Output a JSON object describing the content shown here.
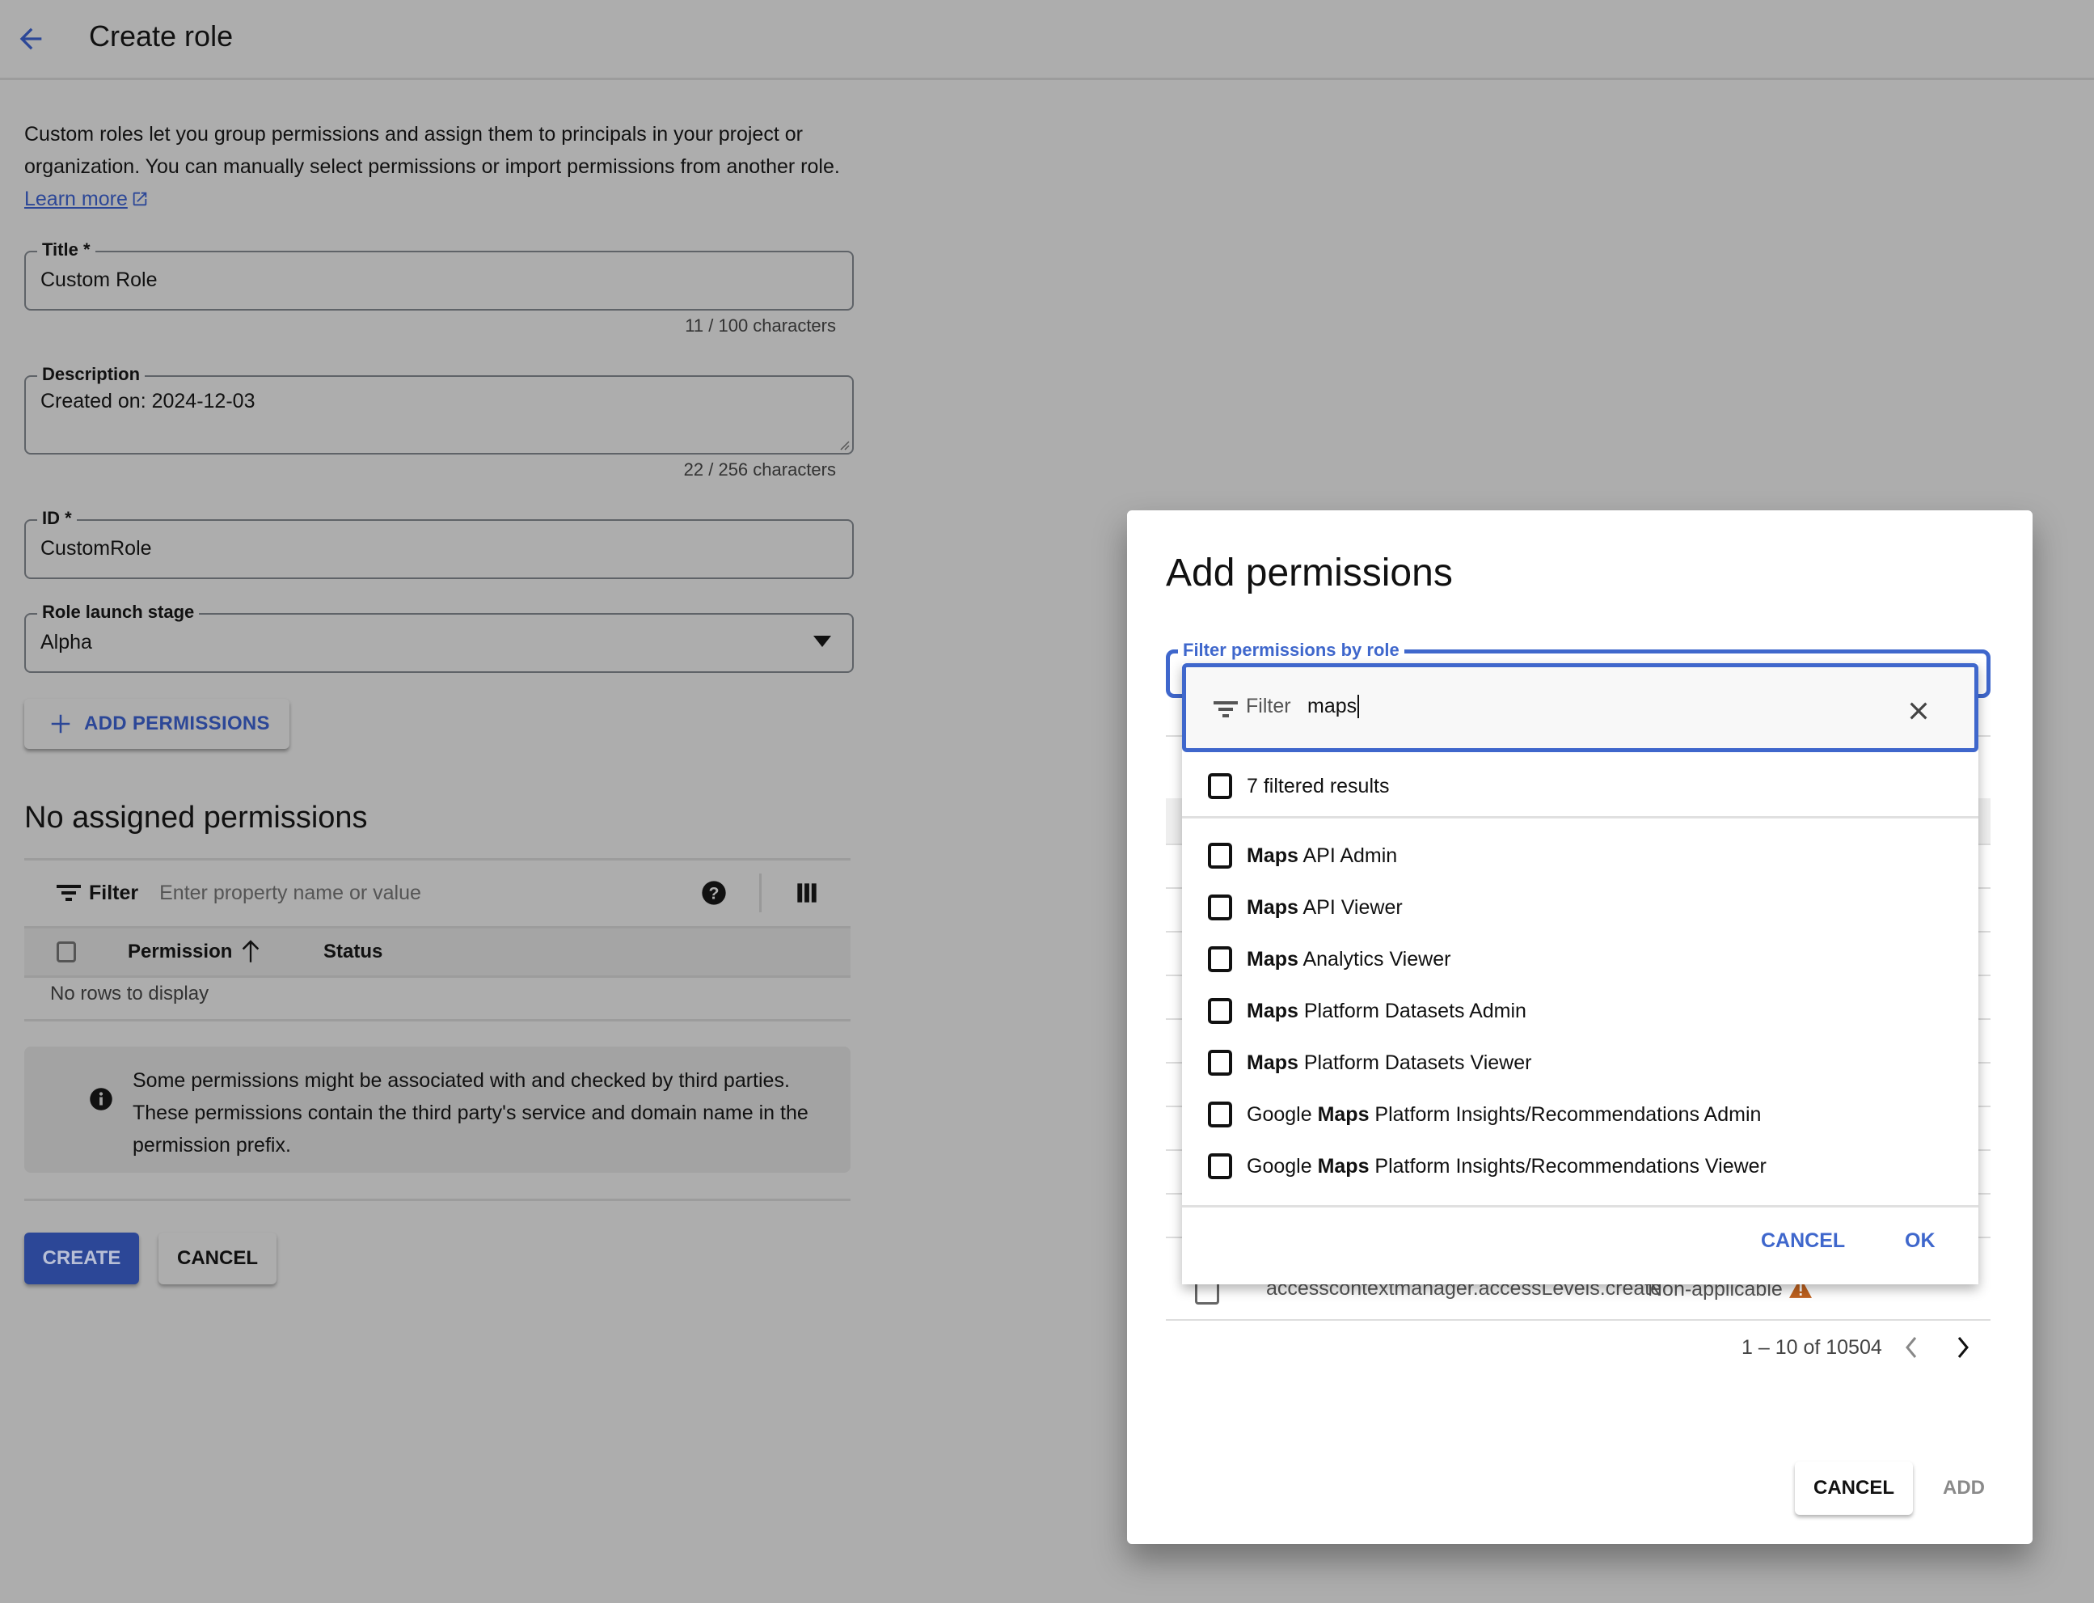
{
  "header": {
    "title": "Create role"
  },
  "intro": {
    "text": "Custom roles let you group permissions and assign them to principals in your project or organization. You can manually select permissions or import permissions from another role.",
    "learn_more": "Learn more"
  },
  "form": {
    "title": {
      "label": "Title *",
      "value": "Custom Role",
      "counter": "11 / 100 characters"
    },
    "description": {
      "label": "Description",
      "value": "Created on: 2024-12-03",
      "counter": "22 / 256 characters"
    },
    "id": {
      "label": "ID *",
      "value": "CustomRole"
    },
    "launch_stage": {
      "label": "Role launch stage",
      "value": "Alpha"
    },
    "add_permissions_label": "ADD PERMISSIONS"
  },
  "assigned": {
    "title": "No assigned permissions",
    "filter_label": "Filter",
    "filter_placeholder": "Enter property name or value",
    "columns": [
      "Permission",
      "Status"
    ],
    "empty_text": "No rows to display",
    "info": "Some permissions might be associated with and checked by third parties. These permissions contain the third party's service and domain name in the permission prefix."
  },
  "actions": {
    "create": "CREATE",
    "cancel": "CANCEL"
  },
  "dialog": {
    "title": "Add permissions",
    "filter_role_label": "Filter permissions by role",
    "search": {
      "prefix": "Filter",
      "value": "maps"
    },
    "select_all_label": "7 filtered results",
    "options": [
      {
        "pre": "",
        "match": "Maps",
        "post": " API Admin"
      },
      {
        "pre": "",
        "match": "Maps",
        "post": " API Viewer"
      },
      {
        "pre": "",
        "match": "Maps",
        "post": " Analytics Viewer"
      },
      {
        "pre": "",
        "match": "Maps",
        "post": " Platform Datasets Admin"
      },
      {
        "pre": "",
        "match": "Maps",
        "post": " Platform Datasets Viewer"
      },
      {
        "pre": "Google ",
        "match": "Maps",
        "post": " Platform Insights/Recommendations Admin"
      },
      {
        "pre": "Google ",
        "match": "Maps",
        "post": " Platform Insights/Recommendations Viewer"
      }
    ],
    "dropdown_cancel": "CANCEL",
    "dropdown_ok": "OK",
    "background_row": {
      "permission": "accesscontextmanager.accessLevels.create",
      "status": "Non-applicable"
    },
    "pagination": "1 – 10 of 10504",
    "cancel": "CANCEL",
    "add": "ADD"
  },
  "colors": {
    "accent": "#3f67cc",
    "primary_button": "#2c4797",
    "warning": "#c0621f",
    "scrim": "#adadad"
  }
}
